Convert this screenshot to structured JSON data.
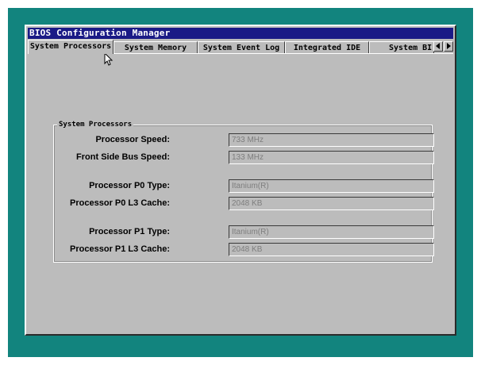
{
  "window": {
    "title": "BIOS Configuration Manager"
  },
  "tabs": [
    {
      "label": "System Processors",
      "active": true
    },
    {
      "label": "System Memory",
      "active": false
    },
    {
      "label": "System Event Log",
      "active": false
    },
    {
      "label": "Integrated IDE",
      "active": false
    },
    {
      "label": "System BI",
      "active": false
    }
  ],
  "tab_scroll": {
    "left_icon": "arrow-left-icon",
    "right_icon": "arrow-right-icon"
  },
  "group": {
    "label": "System Processors",
    "rows": [
      {
        "label": "Processor Speed:",
        "value": "733 MHz"
      },
      {
        "label": "Front Side Bus Speed:",
        "value": "133 MHz"
      },
      {
        "label": "Processor P0 Type:",
        "value": "Itanium(R)"
      },
      {
        "label": "Processor P0 L3 Cache:",
        "value": "2048 KB"
      },
      {
        "label": "Processor P1 Type:",
        "value": "Itanium(R)"
      },
      {
        "label": "Processor P1 L3 Cache:",
        "value": "2048 KB"
      }
    ]
  },
  "colors": {
    "desktop": "#12847e",
    "window": "#bcbcbc",
    "titlebar": "#1a1a86"
  },
  "cursor_icon": "mouse-pointer-icon"
}
